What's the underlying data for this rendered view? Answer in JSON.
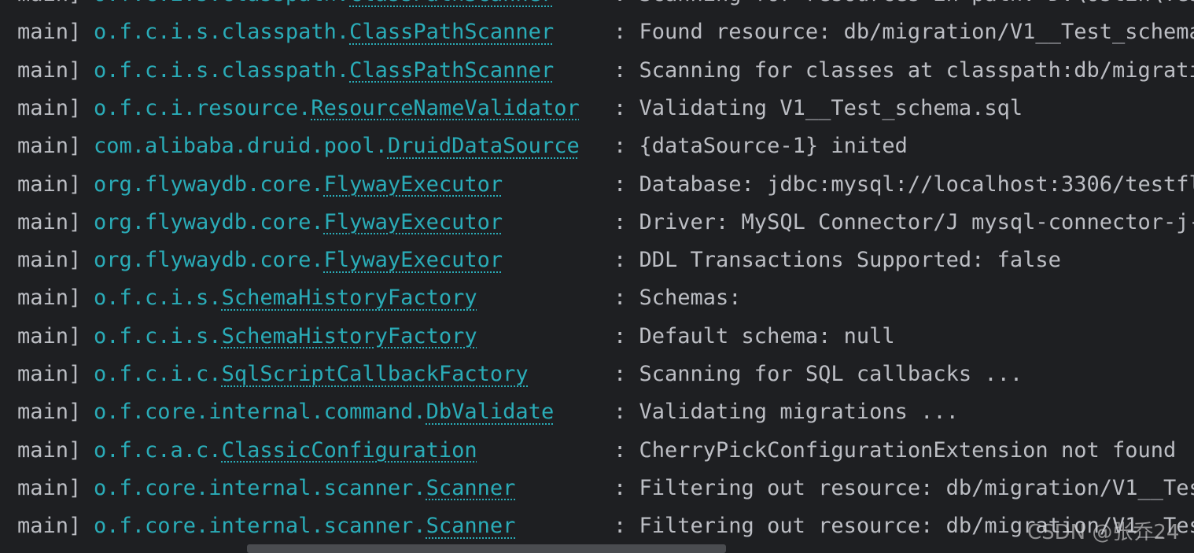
{
  "log_lines": [
    {
      "thread": "main]",
      "pkg": "o.f.c.i.s.classpath.",
      "cls": "ClassPathScanner",
      "message": ": Scanning for resources in path: D:\\ostin\\Tes"
    },
    {
      "thread": "main]",
      "pkg": "o.f.c.i.s.classpath.",
      "cls": "ClassPathScanner",
      "message": ": Found resource: db/migration/V1__Test_schema"
    },
    {
      "thread": "main]",
      "pkg": "o.f.c.i.s.classpath.",
      "cls": "ClassPathScanner",
      "message": ": Scanning for classes at classpath:db/migrati"
    },
    {
      "thread": "main]",
      "pkg": "o.f.c.i.resource.",
      "cls": "ResourceNameValidator",
      "message": ": Validating V1__Test_schema.sql"
    },
    {
      "thread": "main]",
      "pkg": "com.alibaba.druid.pool.",
      "cls": "DruidDataSource",
      "message": ": {dataSource-1} inited"
    },
    {
      "thread": "main]",
      "pkg": "org.flywaydb.core.",
      "cls": "FlywayExecutor",
      "message": ": Database: jdbc:mysql://localhost:3306/testfl"
    },
    {
      "thread": "main]",
      "pkg": "org.flywaydb.core.",
      "cls": "FlywayExecutor",
      "message": ": Driver: MySQL Connector/J mysql-connector-j-"
    },
    {
      "thread": "main]",
      "pkg": "org.flywaydb.core.",
      "cls": "FlywayExecutor",
      "message": ": DDL Transactions Supported: false"
    },
    {
      "thread": "main]",
      "pkg": "o.f.c.i.s.",
      "cls": "SchemaHistoryFactory",
      "message": ": Schemas:"
    },
    {
      "thread": "main]",
      "pkg": "o.f.c.i.s.",
      "cls": "SchemaHistoryFactory",
      "message": ": Default schema: null"
    },
    {
      "thread": "main]",
      "pkg": "o.f.c.i.c.",
      "cls": "SqlScriptCallbackFactory",
      "message": ": Scanning for SQL callbacks ..."
    },
    {
      "thread": "main]",
      "pkg": "o.f.core.internal.command.",
      "cls": "DbValidate",
      "message": ": Validating migrations ..."
    },
    {
      "thread": "main]",
      "pkg": "o.f.c.a.c.",
      "cls": "ClassicConfiguration",
      "message": ": CherryPickConfigurationExtension not found"
    },
    {
      "thread": "main]",
      "pkg": "o.f.core.internal.scanner.",
      "cls": "Scanner",
      "message": ": Filtering out resource: db/migration/V1__Tes"
    },
    {
      "thread": "main]",
      "pkg": "o.f.core.internal.scanner.",
      "cls": "Scanner",
      "message": ": Filtering out resource: db/migration/V1__Tes"
    }
  ],
  "watermark": "CSDN @张乔24",
  "colors": {
    "background": "#1e1f22",
    "text": "#bcbec4",
    "logger": "#2aacb8",
    "scrollbar": "#4a4c50"
  }
}
